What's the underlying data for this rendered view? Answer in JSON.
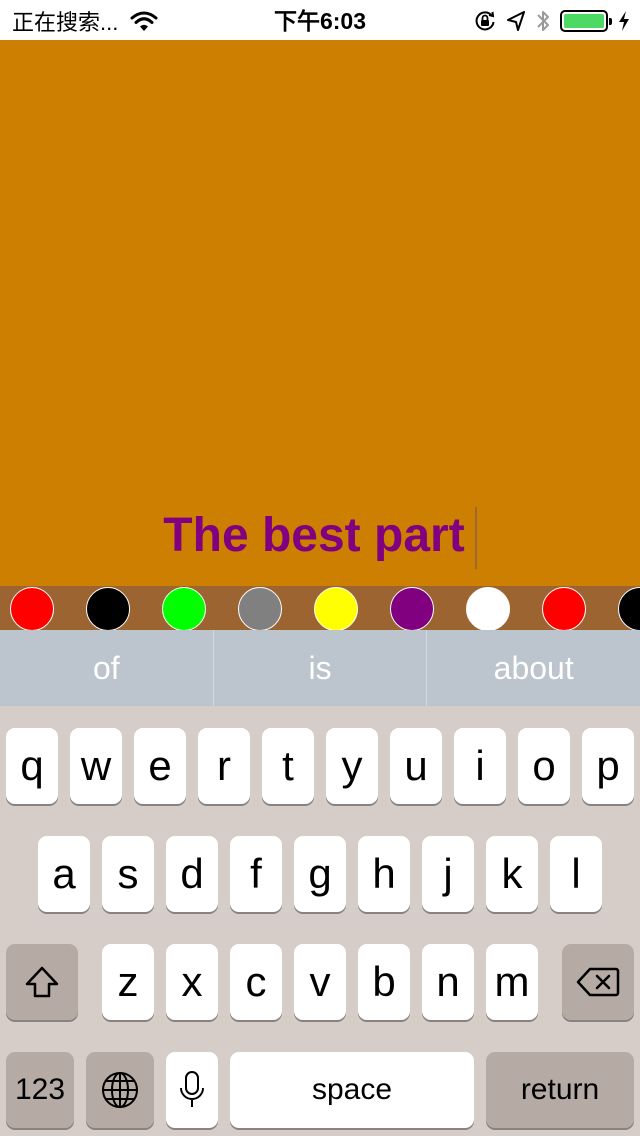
{
  "status_bar": {
    "carrier_text": "正在搜索...",
    "time": "下午6:03",
    "icons": [
      "wifi-icon",
      "orientation-lock-icon",
      "location-icon",
      "bluetooth-icon",
      "battery-icon",
      "charging-icon"
    ],
    "battery_level": 1.0,
    "battery_color": "#4cd964"
  },
  "canvas": {
    "background_color": "#cc7f00",
    "caption": "The best part",
    "caption_color": "#800080"
  },
  "palette": {
    "background_color": "#9b6431",
    "swatches": [
      {
        "name": "red",
        "color": "#ff0000"
      },
      {
        "name": "black",
        "color": "#000000"
      },
      {
        "name": "green",
        "color": "#00ff00"
      },
      {
        "name": "gray",
        "color": "#808080"
      },
      {
        "name": "yellow",
        "color": "#ffff00"
      },
      {
        "name": "purple",
        "color": "#800080"
      },
      {
        "name": "white",
        "color": "#ffffff"
      },
      {
        "name": "red",
        "color": "#ff0000"
      },
      {
        "name": "black",
        "color": "#000000"
      }
    ]
  },
  "predictive": {
    "suggestions": [
      "of",
      "is",
      "about"
    ]
  },
  "keyboard": {
    "row1": [
      "q",
      "w",
      "e",
      "r",
      "t",
      "y",
      "u",
      "i",
      "o",
      "p"
    ],
    "row2": [
      "a",
      "s",
      "d",
      "f",
      "g",
      "h",
      "j",
      "k",
      "l"
    ],
    "row3": [
      "z",
      "x",
      "c",
      "v",
      "b",
      "n",
      "m"
    ],
    "numbers_label": "123",
    "space_label": "space",
    "return_label": "return",
    "icons": {
      "shift": "shift-icon",
      "delete": "backspace-icon",
      "globe": "globe-icon",
      "mic": "microphone-icon"
    }
  }
}
